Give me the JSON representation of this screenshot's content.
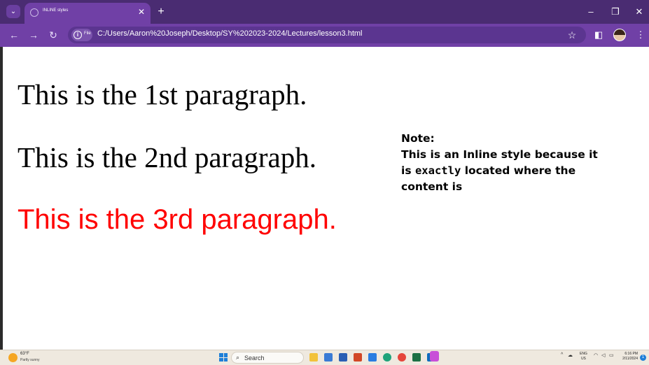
{
  "browser": {
    "tab": {
      "title": "INLINE styles",
      "favicon": "globe-icon"
    },
    "new_tab_label": "+",
    "window_controls": [
      "minimize-icon",
      "restore-icon",
      "close-icon"
    ],
    "nav": [
      "back-icon",
      "forward-icon",
      "reload-icon"
    ],
    "address": {
      "chip_label": "File",
      "url": "C:/Users/Aaron%20Joseph/Desktop/SY%202023-2024/Lectures/lesson3.html"
    },
    "accent_color": "#7040a6",
    "tabbar_color": "#4a2c72"
  },
  "page": {
    "paragraphs": [
      {
        "text": "This is the 1st paragraph.",
        "color": "#000000"
      },
      {
        "text": "This is the 2nd paragraph.",
        "color": "#000000"
      },
      {
        "text": "This is the 3rd paragraph.",
        "color": "#ff0000"
      }
    ],
    "note": {
      "heading": "Note:",
      "text_before": "This is an Inline style because it is",
      "keyword": "exactly",
      "text_after": "located where the content is"
    }
  },
  "taskbar": {
    "weather": {
      "temp": "63°F",
      "desc": "Partly sunny",
      "icon": "sun-cloud-icon"
    },
    "search_placeholder": "Search",
    "apps": [
      "file-explorer-icon",
      "calculator-icon",
      "word-icon",
      "powerpoint-icon",
      "mail-icon",
      "edge-icon",
      "chrome-icon",
      "excel-icon",
      "outlook-icon",
      "paint-icon"
    ],
    "tray": {
      "lang_top": "ENG",
      "lang_bottom": "US",
      "time": "6:16 PM",
      "date": "2/11/2024"
    }
  }
}
